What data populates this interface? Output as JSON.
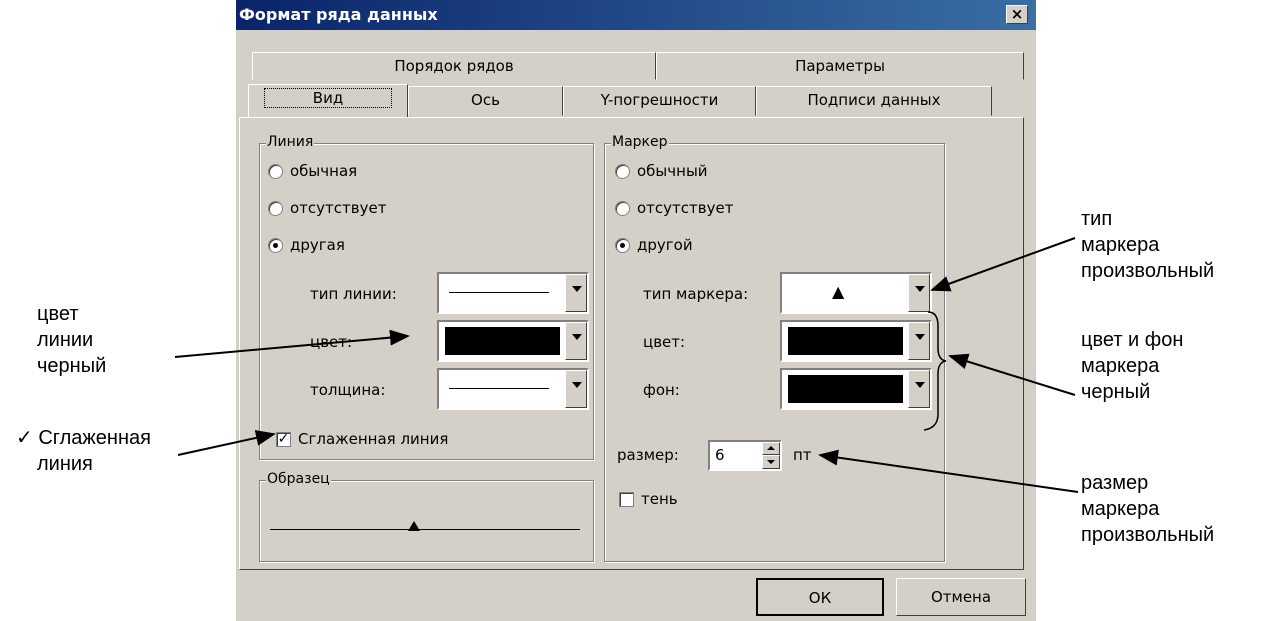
{
  "dialog": {
    "title": "Формат ряда данных",
    "close_label": "×",
    "tabs_back": [
      "Порядок рядов",
      "Параметры"
    ],
    "tabs_front": [
      "Вид",
      "Ось",
      "Y-погрешности",
      "Подписи данных"
    ],
    "active_tab": "Вид"
  },
  "line_group": {
    "legend": "Линия",
    "radio_normal": "обычная",
    "radio_none": "отсутствует",
    "radio_custom": "другая",
    "selected": "другая",
    "type_label": "тип линии:",
    "color_label": "цвет:",
    "thickness_label": "толщина:",
    "line_color": "#000000",
    "smooth_label": "Сглаженная линия",
    "smooth_checked": true
  },
  "sample_group": {
    "legend": "Образец"
  },
  "marker_group": {
    "legend": "Маркер",
    "radio_normal": "обычный",
    "radio_none": "отсутствует",
    "radio_custom": "другой",
    "selected": "другой",
    "type_label": "тип маркера:",
    "type_value": "▲",
    "color_label": "цвет:",
    "bg_label": "фон:",
    "marker_color": "#000000",
    "marker_bg": "#000000",
    "size_label": "размер:",
    "size_value": "6",
    "size_unit": "пт",
    "shadow_label": "тень",
    "shadow_checked": false
  },
  "buttons": {
    "ok": "ОК",
    "cancel": "Отмена"
  },
  "annotations": {
    "marker_type": [
      "тип",
      "маркера",
      "произвольный"
    ],
    "line_color": [
      "цвет",
      "линии",
      "черный"
    ],
    "marker_color": [
      "цвет и фон",
      "маркера",
      "черный"
    ],
    "smooth": [
      "✓ Сглаженная",
      "линия"
    ],
    "marker_size": [
      "размер",
      "маркера",
      "произвольный"
    ]
  }
}
